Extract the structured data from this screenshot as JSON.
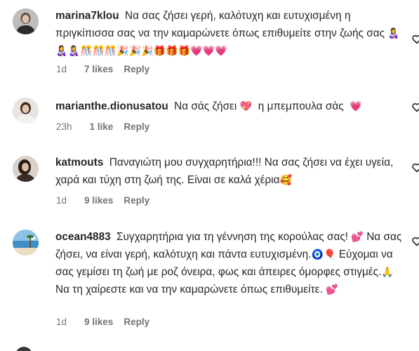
{
  "comments": [
    {
      "username": "marina7klou",
      "text": "Να σας ζήσει γερή, καλότυχη και ευτυχισμένη η πριγκίπισσα σας να την καμαρώνετε όπως επιθυμείτε στην ζωής σας",
      "emojis": "👩‍🍼👩‍🍼👩‍🍼🎊🎊🎊🎉🎉🎉🎁🎁🎁💗💗💗",
      "time": "1d",
      "likes": "7 likes",
      "reply": "Reply"
    },
    {
      "username": "marianthe.dionusatou",
      "text_a": "Να σάς ζήσει",
      "emoji_a": "💖",
      "text_b": "η μπεμπουλα σάς",
      "emoji_b": "💗",
      "time": "23h",
      "likes": "1 like",
      "reply": "Reply"
    },
    {
      "username": "katmouts",
      "text": "Παναγιώτη μου συγχαρητήρια!!! Να σας ζήσει να έχει υγεία, χαρά και τύχη στη ζωή της. Είναι σε καλά χέρια",
      "emoji": "🥰",
      "time": "1d",
      "likes": "9 likes",
      "reply": "Reply"
    },
    {
      "username": "ocean4883",
      "text_a": "Συγχαρητήρια για τη γέννηση της κορούλας σας!",
      "emoji_a": "💕",
      "text_b": "Να σας ζήσει, να είναι γερή, καλότυχη και πάντα ευτυχισμένη.",
      "emoji_b": "🧿🎈",
      "text_c": "Εύχομαι να σας γεμίσει τη ζωή με ροζ όνειρα, φως και άπειρες όμορφες στιγμές.",
      "emoji_c": "🙏",
      "text_d": "Να τη χαίρεστε και να την καμαρώνετε όπως επιθυμείτε.",
      "emoji_d": "💕",
      "time": "1d",
      "likes": "9 likes",
      "reply": "Reply"
    }
  ],
  "icons": {
    "like": "heart-outline-icon"
  },
  "colors": {
    "text": "#262626",
    "meta": "#737373"
  }
}
